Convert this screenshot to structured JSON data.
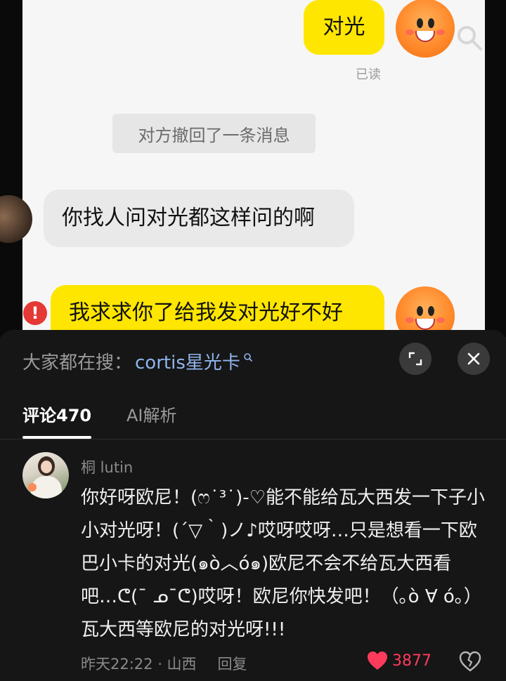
{
  "chat": {
    "msg_me_1": "对光",
    "read_status": "已读",
    "recall_notice": "对方撤回了一条消息",
    "msg_other": "你找人问对光都这样问的啊",
    "msg_me_2": "我求求你了给我发对光好不好",
    "failed_mark": "!"
  },
  "panel": {
    "hot_search_prefix": "大家都在搜：",
    "hot_search_term": "cortis星光卡",
    "tabs": [
      {
        "label": "评论470",
        "active": true
      },
      {
        "label": "AI解析",
        "active": false
      }
    ]
  },
  "comment": {
    "username": "桐 lutin",
    "text": "你好呀欧尼！(ෆ˙³˙)-♡能不能给瓦大西发一下子小小对光呀！(´▽｀)ノ♪哎呀哎呀…只是想看一下欧巴小卡的对光(๑ò︿ó๑)欧尼不会不给瓦大西看吧…ᕦ(¯ ᓄ¯ᕦ)哎呀！欧尼你快发吧！（｡ò ∀ ó｡）瓦大西等欧尼的对光呀!!!",
    "time_location": "昨天22:22 · 山西",
    "reply_label": "回复",
    "like_count": "3877"
  },
  "colors": {
    "bubble_mine": "#ffe600",
    "bubble_other": "#e9e9e9",
    "link_blue": "#8fb4ec",
    "like_red": "#ff3b5c",
    "warning_red": "#e53935"
  },
  "icons": [
    "search-icon",
    "expand-icon",
    "close-icon",
    "heart-icon",
    "dislike-heart-icon",
    "warning-icon"
  ]
}
